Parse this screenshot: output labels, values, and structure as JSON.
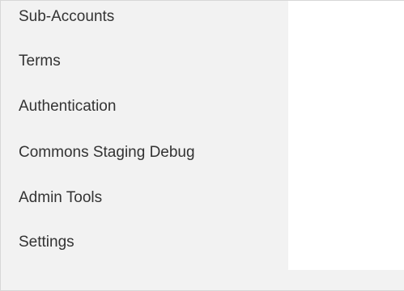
{
  "sidebar": {
    "items": [
      {
        "label": "Sub-Accounts"
      },
      {
        "label": "Terms"
      },
      {
        "label": "Authentication"
      },
      {
        "label": "Commons Staging Debug"
      },
      {
        "label": "Admin Tools"
      },
      {
        "label": "Settings"
      }
    ]
  },
  "colors": {
    "sidebar_background": "#f2f2f2",
    "content_background": "#ffffff",
    "text": "#333333"
  }
}
